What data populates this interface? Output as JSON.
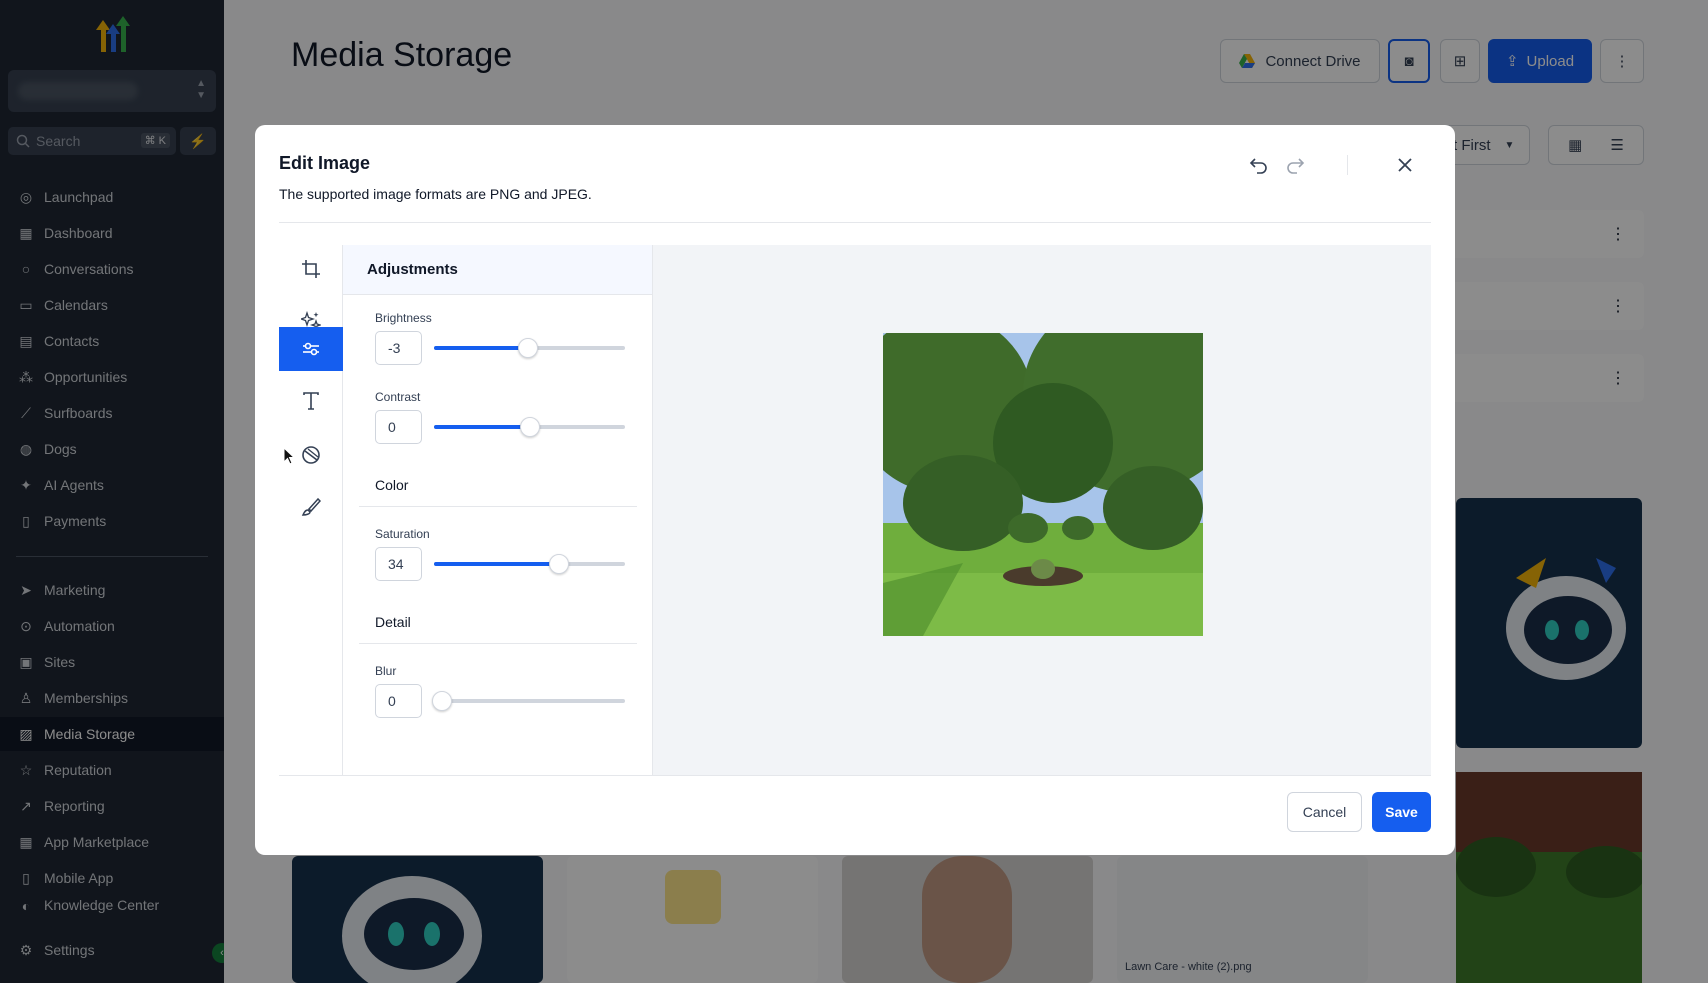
{
  "sidebar": {
    "search_placeholder": "Search",
    "search_shortcut": "⌘ K",
    "items": [
      {
        "label": "Launchpad",
        "icon": "launchpad-icon"
      },
      {
        "label": "Dashboard",
        "icon": "dashboard-icon"
      },
      {
        "label": "Conversations",
        "icon": "chat-icon"
      },
      {
        "label": "Calendars",
        "icon": "calendar-icon"
      },
      {
        "label": "Contacts",
        "icon": "contacts-icon"
      },
      {
        "label": "Opportunities",
        "icon": "opportunities-icon"
      },
      {
        "label": "Surfboards",
        "icon": "surfboard-icon"
      },
      {
        "label": "Dogs",
        "icon": "dog-icon"
      },
      {
        "label": "AI Agents",
        "icon": "sparkle-icon"
      },
      {
        "label": "Payments",
        "icon": "payments-icon"
      },
      {
        "label": "Marketing",
        "icon": "send-icon"
      },
      {
        "label": "Automation",
        "icon": "automation-icon"
      },
      {
        "label": "Sites",
        "icon": "sites-icon"
      },
      {
        "label": "Memberships",
        "icon": "membership-icon"
      },
      {
        "label": "Media Storage",
        "icon": "image-icon"
      },
      {
        "label": "Reputation",
        "icon": "star-icon"
      },
      {
        "label": "Reporting",
        "icon": "chart-icon"
      },
      {
        "label": "App Marketplace",
        "icon": "apps-icon"
      },
      {
        "label": "Mobile App",
        "icon": "mobile-icon"
      },
      {
        "label": "Knowledge Center",
        "icon": "book-icon"
      }
    ],
    "settings_label": "Settings"
  },
  "page": {
    "title": "Media Storage",
    "connect_drive": "Connect Drive",
    "upload": "Upload",
    "sort_partial": "t First",
    "bg_file_label": "Lawn Care - white (2).png"
  },
  "modal": {
    "title": "Edit Image",
    "subtitle": "The supported image formats are PNG and JPEG.",
    "panel_title": "Adjustments",
    "sliders": {
      "brightness": {
        "label": "Brightness",
        "value": "-3",
        "fraction": 0.49
      },
      "contrast": {
        "label": "Contrast",
        "value": "0",
        "fraction": 0.5
      },
      "saturation": {
        "label": "Saturation",
        "value": "34",
        "fraction": 0.655
      },
      "blur": {
        "label": "Blur",
        "value": "0",
        "fraction": 0.0
      }
    },
    "sections": {
      "color": "Color",
      "detail": "Detail"
    },
    "cancel": "Cancel",
    "save": "Save"
  },
  "colors": {
    "accent": "#155eef",
    "sidebar_bg": "#1f2733"
  }
}
